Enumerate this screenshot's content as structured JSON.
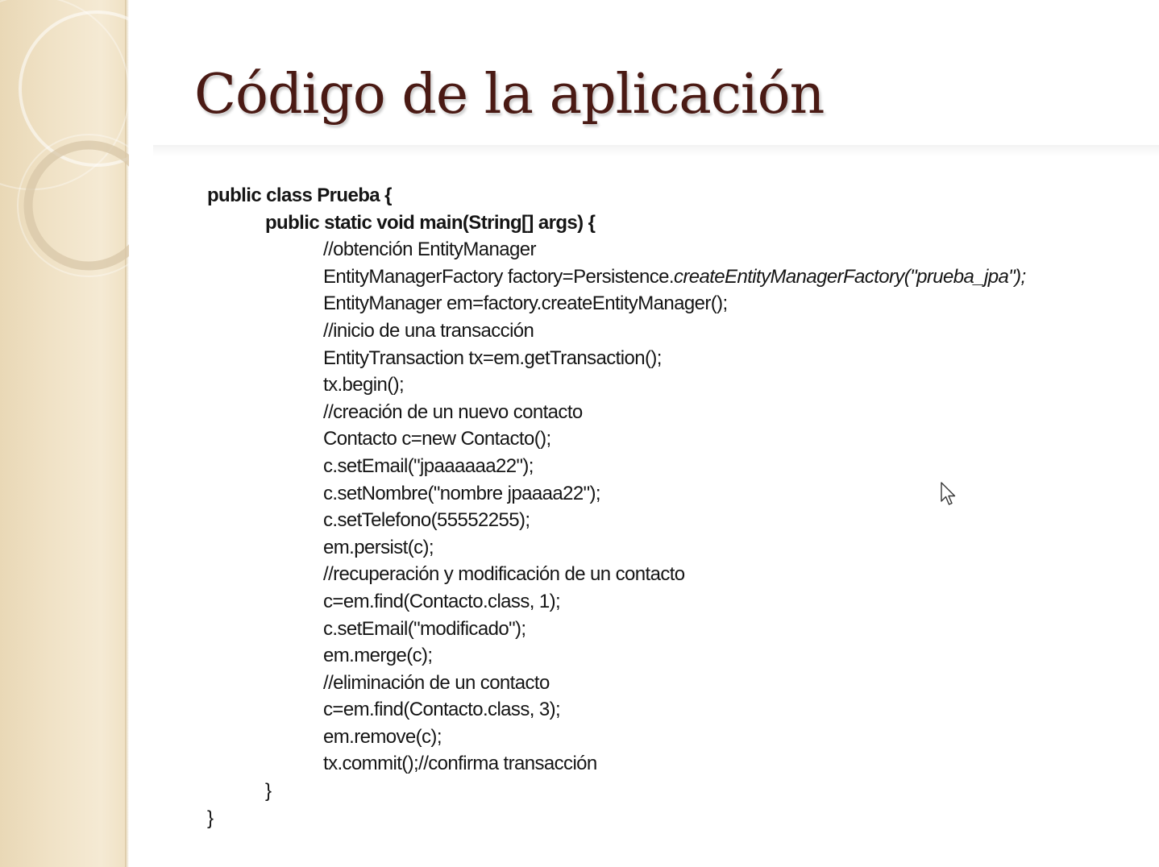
{
  "slide": {
    "title": "Código de la aplicación"
  },
  "code": {
    "class_open": "public class Prueba {",
    "main_open": "public static void main(String[] args) {",
    "comment_obtain": "//obtención EntityManager",
    "factory_prefix": "EntityManagerFactory factory=Persistence.",
    "factory_italic": "createEntityManagerFactory(\"prueba_jpa\");",
    "em_line": "EntityManager em=factory.createEntityManager();",
    "comment_tx_start": "//inicio de una transacción",
    "tx_line": "EntityTransaction tx=em.getTransaction();",
    "tx_begin": "tx.begin();",
    "comment_create": "//creación de un nuevo contacto",
    "new_contact": "Contacto c=new Contacto();",
    "set_email": "c.setEmail(\"jpaaaaaa22\");",
    "set_nombre": "c.setNombre(\"nombre jpaaaa22\");",
    "set_telefono": "c.setTelefono(55552255);",
    "persist": "em.persist(c);",
    "comment_update": "//recuperación y modificación de un contacto",
    "find_1": "c=em.find(Contacto.class, 1);",
    "set_email_mod": "c.setEmail(\"modificado\");",
    "merge": "em.merge(c);",
    "comment_delete": "//eliminación de un contacto",
    "find_3": "c=em.find(Contacto.class, 3);",
    "remove": "em.remove(c);",
    "commit": "tx.commit();//confirma transacción",
    "main_close": "}",
    "class_close": "}"
  },
  "colors": {
    "title": "#4a1a14",
    "text": "#151515",
    "side_band": "#f0e2c6"
  },
  "icons": {
    "cursor": "mouse-pointer-icon"
  }
}
